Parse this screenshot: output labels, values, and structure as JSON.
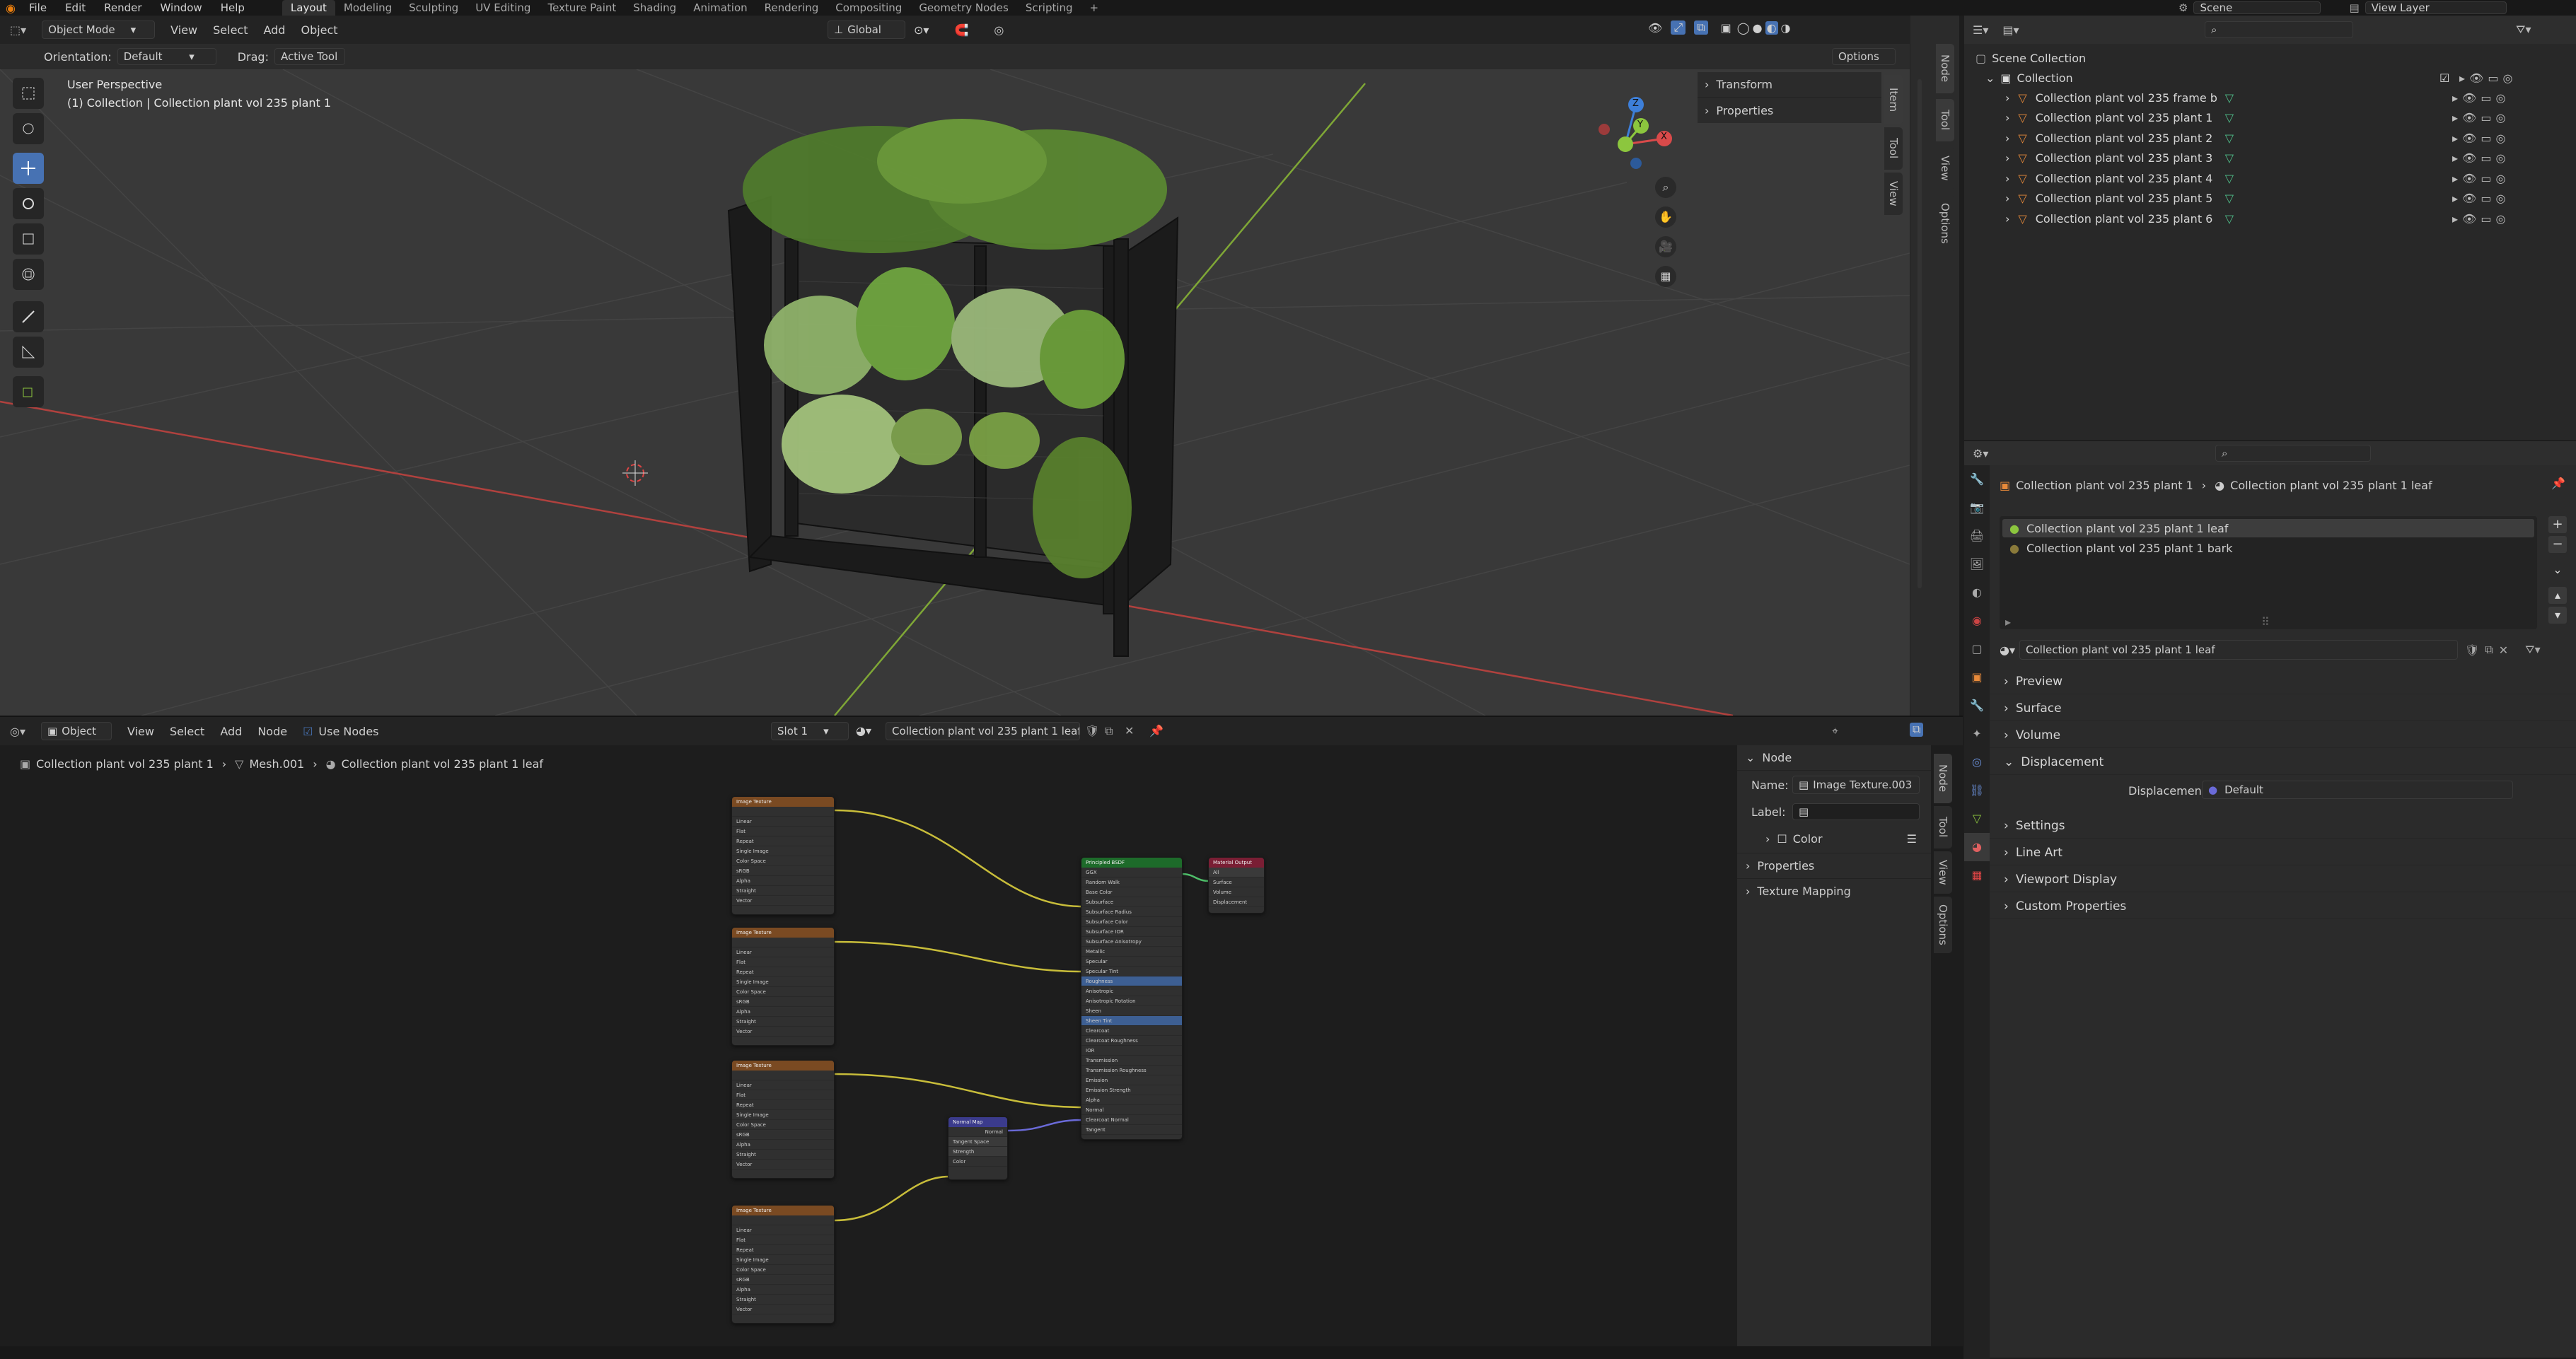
{
  "topbar": {
    "menus": [
      "File",
      "Edit",
      "Render",
      "Window",
      "Help"
    ],
    "workspaces": [
      "Layout",
      "Modeling",
      "Sculpting",
      "UV Editing",
      "Texture Paint",
      "Shading",
      "Animation",
      "Rendering",
      "Compositing",
      "Geometry Nodes",
      "Scripting"
    ],
    "active_workspace": "Layout",
    "add_tab": "+",
    "scene_label": "Scene",
    "view_layer_label": "View Layer"
  },
  "viewport": {
    "mode": "Object Mode",
    "menus": [
      "View",
      "Select",
      "Add",
      "Object"
    ],
    "transform_orientation": "Global",
    "orientation_label": "Orientation:",
    "orientation_value": "Default",
    "drag_label": "Drag:",
    "drag_value": "Active Tool",
    "options_label": "Options",
    "perspective_text": "User Perspective",
    "context_text": "(1) Collection | Collection plant vol 235 plant 1",
    "n_panel_sections": [
      "Transform",
      "Properties"
    ],
    "side_tabs": [
      "Item",
      "Tool",
      "View"
    ],
    "gizmo_axes": {
      "x": "X",
      "y": "Y",
      "z": "Z"
    }
  },
  "outliner": {
    "root": "Scene Collection",
    "collection": "Collection",
    "items": [
      "Collection plant vol 235 frame b",
      "Collection plant vol 235 plant 1",
      "Collection plant vol 235 plant 2",
      "Collection plant vol 235 plant 3",
      "Collection plant vol 235 plant 4",
      "Collection plant vol 235 plant 5",
      "Collection plant vol 235 plant 6"
    ]
  },
  "node_editor": {
    "object_mode": "Object",
    "menus": [
      "View",
      "Select",
      "Add",
      "Node"
    ],
    "use_nodes_label": "Use Nodes",
    "slot": "Slot 1",
    "material": "Collection plant vol 235 plant 1 leaf",
    "breadcrumb": [
      "Collection plant vol 235 plant 1",
      "Mesh.001",
      "Collection plant vol 235 plant 1 leaf"
    ],
    "side_tabs": [
      "Node",
      "Tool",
      "View",
      "Options"
    ],
    "node_panel": {
      "title": "Node",
      "name_label": "Name:",
      "name_value": "Image Texture.003",
      "label_label": "Label:",
      "label_value": "",
      "color_label": "Color",
      "sections": [
        "Properties",
        "Texture Mapping"
      ]
    },
    "nodes": {
      "image_texture": "Image Texture",
      "principled": "Principled BSDF",
      "normal_map": "Normal Map",
      "material_output": "Material Output",
      "image_rows": [
        "Linear",
        "Flat",
        "Repeat",
        "Single Image",
        "Color Space",
        "sRGB",
        "Alpha",
        "Straight",
        "Vector"
      ],
      "principled_rows": [
        "GGX",
        "Random Walk",
        "Base Color",
        "Subsurface",
        "Subsurface Radius",
        "Subsurface Color",
        "Subsurface IOR",
        "Subsurface Anisotropy",
        "Metallic",
        "Specular",
        "Specular Tint",
        "Roughness",
        "Anisotropic",
        "Anisotropic Rotation",
        "Sheen",
        "Sheen Tint",
        "Clearcoat",
        "Clearcoat Roughness",
        "IOR",
        "Transmission",
        "Transmission Roughness",
        "Emission",
        "Emission Strength",
        "Alpha",
        "Normal",
        "Clearcoat Normal",
        "Tangent"
      ],
      "normal_rows": [
        "Normal",
        "Tangent Space",
        "Strength",
        "Color"
      ],
      "output_rows": [
        "All",
        "Surface",
        "Volume",
        "Displacement"
      ]
    }
  },
  "properties": {
    "breadcrumb_object": "Collection plant vol 235 plant 1",
    "breadcrumb_material": "Collection plant vol 235 plant 1 leaf",
    "material_slots": [
      "Collection plant vol 235 plant 1 leaf",
      "Collection plant vol 235 plant 1 bark"
    ],
    "material_name": "Collection plant vol 235 plant 1 leaf",
    "sections": [
      "Preview",
      "Surface",
      "Volume",
      "Displacement",
      "Settings",
      "Line Art",
      "Viewport Display",
      "Custom Properties"
    ],
    "displacement_label": "Displacement",
    "displacement_value": "Default"
  },
  "colors": {
    "accent": "#4772b3",
    "x_axis": "#d94a4a",
    "y_axis": "#8cc63e",
    "z_axis": "#3d7fd9",
    "image_node_header": "#7a4a22",
    "principled_header": "#1d6b2a",
    "normal_header": "#3b3b8c",
    "output_header": "#7a1e34",
    "link_yellow": "#c8bd3a",
    "link_blue": "#6a6ad8"
  }
}
